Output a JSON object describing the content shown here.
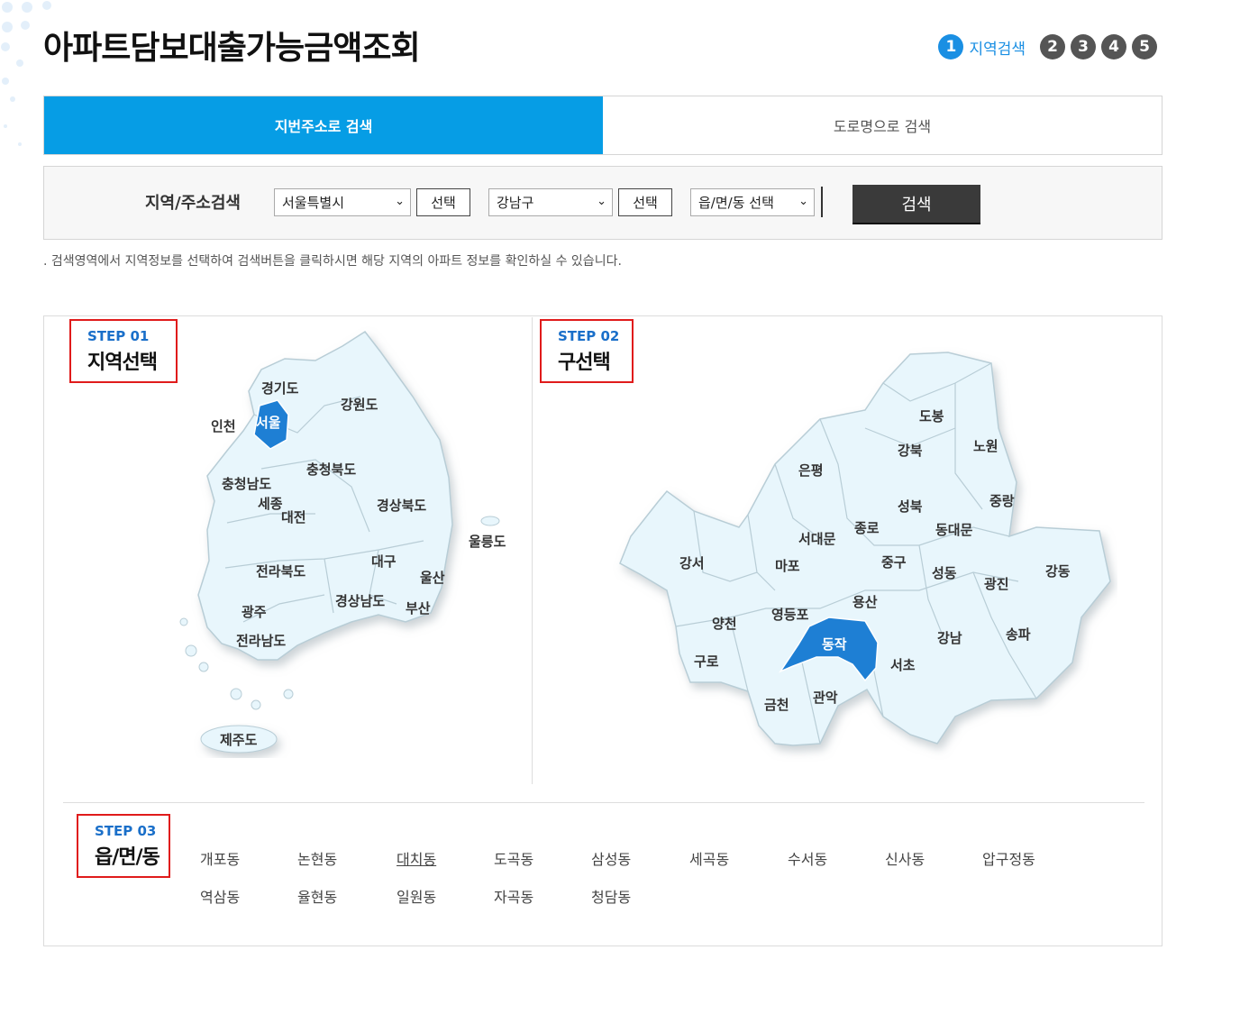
{
  "page": {
    "title": "아파트담보대출가능금액조회"
  },
  "steps": {
    "active_number": "1",
    "active_label": "지역검색",
    "others": [
      "2",
      "3",
      "4",
      "5"
    ]
  },
  "tabs": [
    {
      "label": "지번주소로 검색",
      "active": true
    },
    {
      "label": "도로명으로 검색",
      "active": false
    }
  ],
  "search": {
    "label": "지역/주소검색",
    "sido": "서울특별시",
    "sigungu": "강남구",
    "dong": "읍/면/동 선택",
    "select_btn": "선택",
    "search_btn": "검색"
  },
  "help_text": ". 검색영역에서 지역정보를 선택하여 검색버튼을 클릭하시면 해당 지역의 아파트 정보를 확인하실 수 있습니다.",
  "step1": {
    "tag": "STEP 01",
    "name": "지역선택"
  },
  "step2": {
    "tag": "STEP 02",
    "name": "구선택"
  },
  "step3": {
    "tag": "STEP 03",
    "name": "읍/면/동"
  },
  "korea_map": {
    "selected": "서울",
    "labels": [
      "경기도",
      "강원도",
      "인천",
      "서울",
      "충청북도",
      "충청남도",
      "세종",
      "대전",
      "경상북도",
      "울릉도",
      "대구",
      "전라북도",
      "울산",
      "경상남도",
      "부산",
      "광주",
      "전라남도",
      "제주도"
    ]
  },
  "seoul_map": {
    "selected": "동작",
    "labels": [
      "도봉",
      "노원",
      "강북",
      "은평",
      "성북",
      "중랑",
      "종로",
      "동대문",
      "서대문",
      "강서",
      "마포",
      "중구",
      "성동",
      "광진",
      "강동",
      "양천",
      "영등포",
      "용산",
      "동작",
      "강남",
      "송파",
      "구로",
      "서초",
      "금천",
      "관악"
    ]
  },
  "dongs": {
    "row1": [
      "개포동",
      "논현동",
      "대치동",
      "도곡동",
      "삼성동",
      "세곡동",
      "수서동",
      "신사동",
      "압구정동"
    ],
    "row2": [
      "역삼동",
      "율현동",
      "일원동",
      "자곡동",
      "청담동"
    ],
    "underlined": "대치동"
  },
  "colors": {
    "accent": "#069de5",
    "map_fill": "#e8f6fc",
    "map_selected": "#1e7fd4",
    "highlight_box": "#e01b1b"
  }
}
